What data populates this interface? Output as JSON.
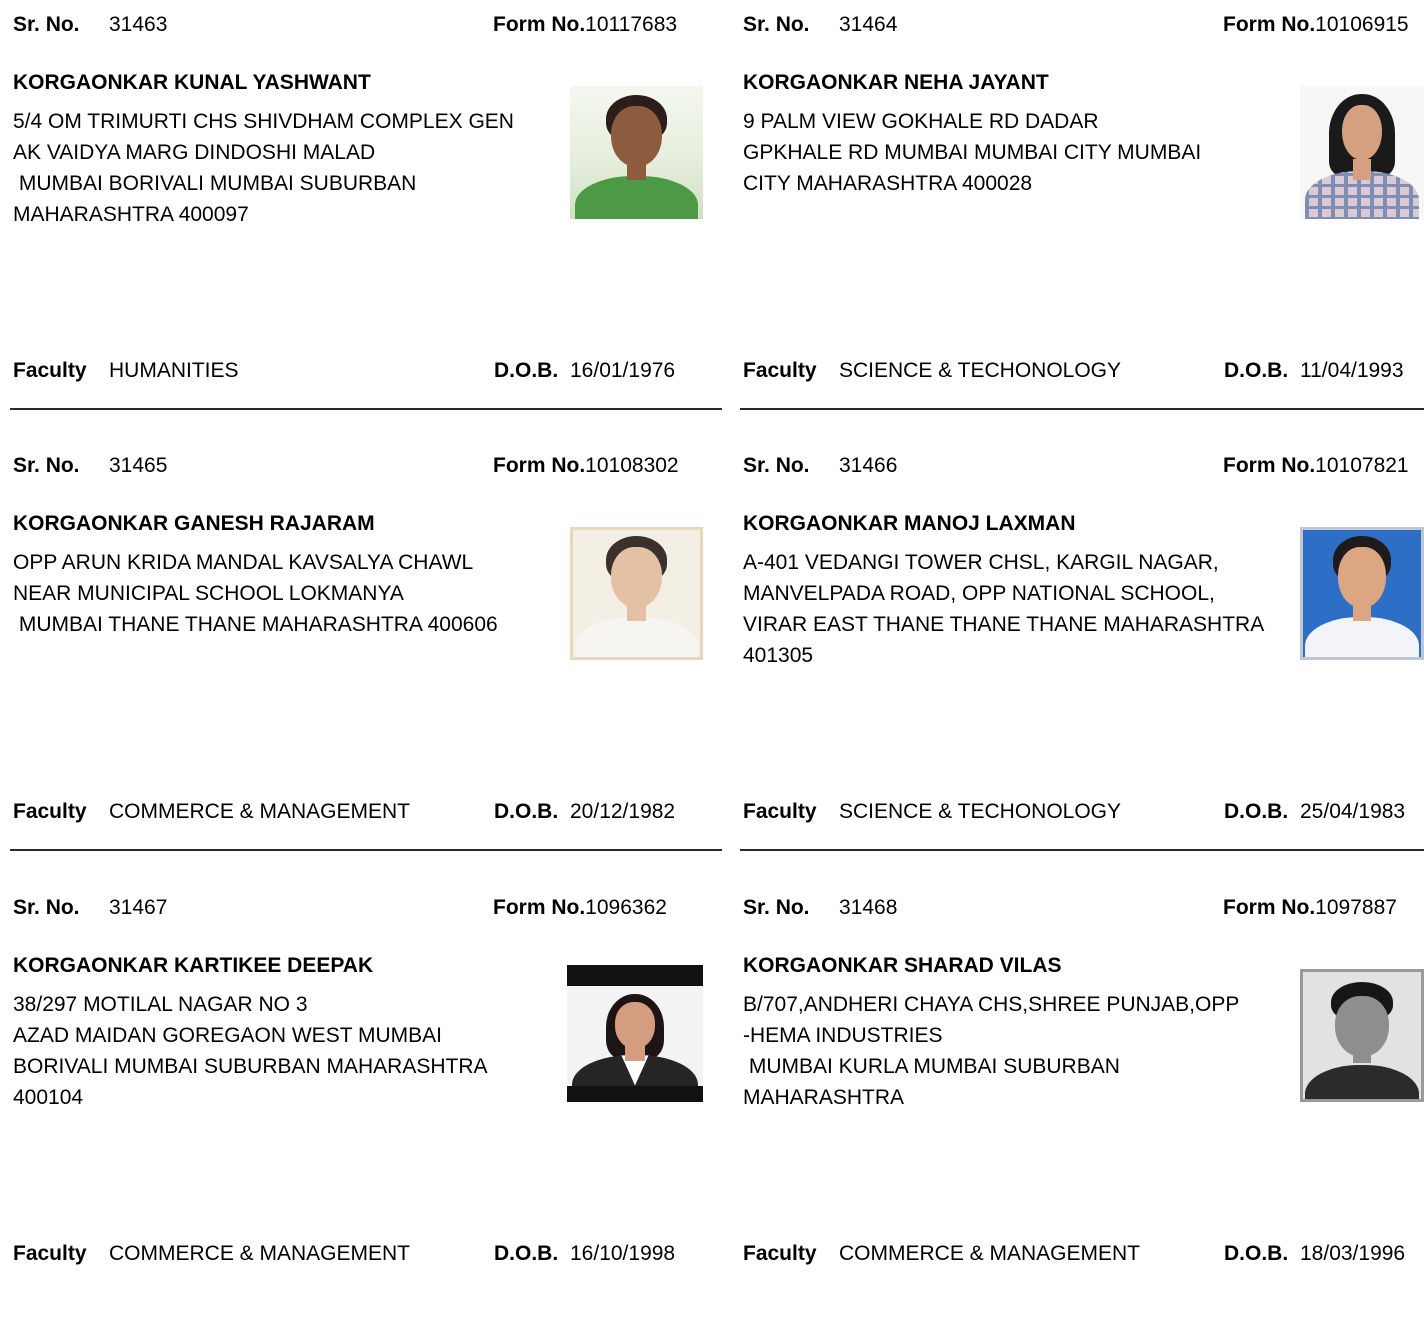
{
  "labels": {
    "sr_no": "Sr. No.",
    "form_no": "Form No.",
    "faculty": "Faculty",
    "dob": "D.O.B."
  },
  "records": [
    {
      "sr_no": "31463",
      "form_no": "10117683",
      "name": "KORGAONKAR KUNAL YASHWANT",
      "address_lines": [
        "5/4 OM TRIMURTI CHS SHIVDHAM COMPLEX GEN",
        "AK VAIDYA MARG DINDOSHI MALAD",
        " MUMBAI BORIVALI MUMBAI SUBURBAN",
        "MAHARASHTRA 400097"
      ],
      "faculty": "HUMANITIES",
      "dob": "16/01/1976",
      "photo": {
        "bg": "#e6eedd",
        "skin": "#8d5b3f",
        "hair": "#2b1d17",
        "shirt": "#4c9a45"
      }
    },
    {
      "sr_no": "31464",
      "form_no": "10106915",
      "name": "KORGAONKAR NEHA JAYANT",
      "address_lines": [
        "9 PALM VIEW GOKHALE RD DADAR",
        "GPKHALE RD MUMBAI MUMBAI CITY MUMBAI",
        "CITY MAHARASHTRA 400028"
      ],
      "faculty": "SCIENCE & TECHONOLOGY",
      "dob": "11/04/1993",
      "photo": {
        "bg": "#f7f7f7",
        "skin": "#d4a07f",
        "hair": "#1a1a1a",
        "shirt": "#dcc9d6",
        "accent": "#7f8fb3"
      }
    },
    {
      "sr_no": "31465",
      "form_no": "10108302",
      "name": "KORGAONKAR GANESH RAJARAM",
      "address_lines": [
        "OPP ARUN KRIDA MANDAL KAVSALYA CHAWL",
        "NEAR MUNICIPAL SCHOOL LOKMANYA",
        " MUMBAI THANE THANE MAHARASHTRA 400606"
      ],
      "faculty": "COMMERCE & MANAGEMENT",
      "dob": "20/12/1982",
      "photo": {
        "bg": "#f4efe4",
        "skin": "#e4c0a4",
        "hair": "#3b302c",
        "shirt": "#f7f5f1",
        "frame": "#e6d7bd"
      }
    },
    {
      "sr_no": "31466",
      "form_no": "10107821",
      "name": "KORGAONKAR MANOJ LAXMAN",
      "address_lines": [
        "A-401 VEDANGI TOWER CHSL, KARGIL NAGAR,",
        "MANVELPADA ROAD, OPP NATIONAL SCHOOL,",
        "VIRAR EAST THANE THANE THANE MAHARASHTRA",
        "401305"
      ],
      "faculty": "SCIENCE & TECHONOLOGY",
      "dob": "25/04/1983",
      "photo": {
        "bg": "#2d6fc6",
        "skin": "#dca683",
        "hair": "#1f1b1b",
        "shirt": "#f3f4f7",
        "frame": "#bfc6cf"
      }
    },
    {
      "sr_no": "31467",
      "form_no": "1096362",
      "name": "KORGAONKAR KARTIKEE DEEPAK",
      "address_lines": [
        "38/297 MOTILAL NAGAR NO 3",
        "AZAD MAIDAN GOREGAON WEST MUMBAI",
        "BORIVALI MUMBAI SUBURBAN MAHARASHTRA",
        "400104"
      ],
      "faculty": "COMMERCE & MANAGEMENT",
      "dob": "16/10/1998",
      "photo": {
        "bg": "#f3f3f3",
        "skin": "#d49d7f",
        "hair": "#1d1513",
        "shirt": "#252525",
        "accent": "#ffffff",
        "strip": "#111111"
      }
    },
    {
      "sr_no": "31468",
      "form_no": "1097887",
      "name": "KORGAONKAR SHARAD VILAS",
      "address_lines": [
        "B/707,ANDHERI CHAYA CHS,SHREE PUNJAB,OPP",
        "-HEMA INDUSTRIES",
        " MUMBAI KURLA MUMBAI SUBURBAN",
        "MAHARASHTRA"
      ],
      "faculty": "COMMERCE & MANAGEMENT",
      "dob": "18/03/1996",
      "photo": {
        "bg": "#e2e2e2",
        "skin": "#8e8e8e",
        "hair": "#161616",
        "shirt": "#2b2b2b",
        "frame": "#9a9a9a"
      }
    }
  ]
}
